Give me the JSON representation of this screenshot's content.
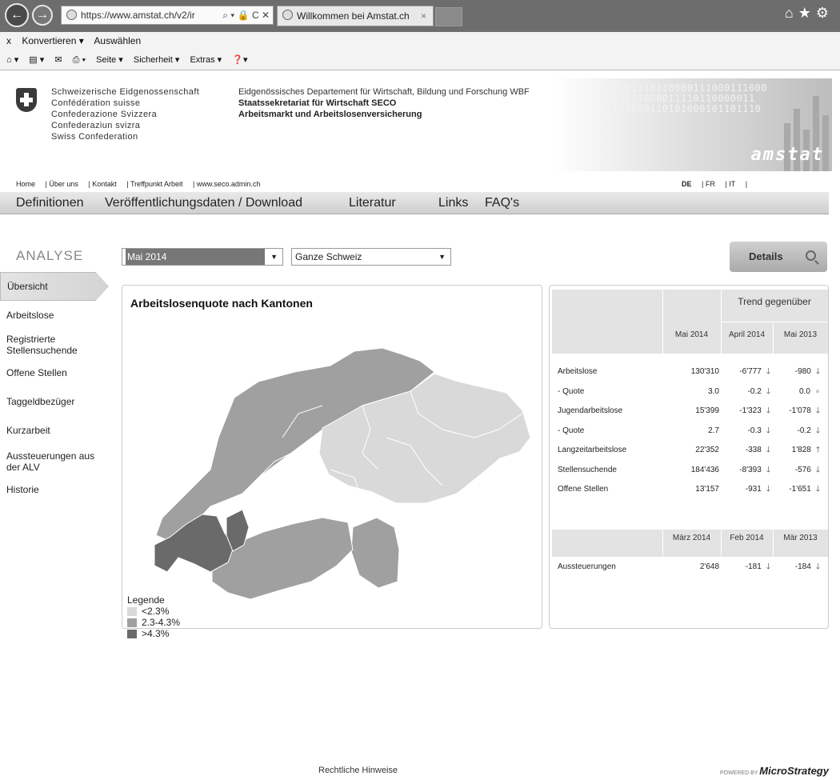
{
  "browser": {
    "address": "https://www.amstat.ch/v2/ir",
    "tab_title": "Willkommen bei Amstat.ch",
    "tab_close": "×",
    "address_tools": "⌕ ▾ 🔒 C ✕",
    "command_bar": {
      "close": "x",
      "convert": "Konvertieren ▾",
      "select": "Auswählen"
    },
    "toolbar": {
      "page": "Seite ▾",
      "security": "Sicherheit ▾",
      "extras": "Extras ▾",
      "help": "❓▾"
    }
  },
  "header": {
    "confederation": [
      "Schweizerische Eidgenossenschaft",
      "Confédération suisse",
      "Confederazione Svizzera",
      "Confederaziun svizra",
      "Swiss Confederation"
    ],
    "department": "Eidgenössisches Departement für Wirtschaft, Bildung und Forschung WBF",
    "secretariat": "Staatssekretariat für Wirtschaft SECO",
    "unit": "Arbeitsmarkt und Arbeitslosenversicherung",
    "brand": "amstat",
    "banner_bits": [
      "0101110110000111000111000",
      "01101000011110110000011",
      "000000110101000101101110"
    ]
  },
  "topnav": [
    "Home",
    "| Über uns",
    "| Kontakt",
    "| Treffpunkt Arbeit",
    "| www.seco.admin.ch"
  ],
  "languages": [
    "DE",
    "| FR",
    "| IT",
    "|"
  ],
  "mainnav": [
    "Definitionen",
    "Veröffentlichungsdaten / Download",
    "Literatur",
    "Links",
    "FAQ's"
  ],
  "analyse_label": "ANALYSE",
  "filters": {
    "month": "Mai 2014",
    "region": "Ganze Schweiz"
  },
  "details_label": "Details",
  "sidebar": [
    {
      "label": "Übersicht",
      "active": true
    },
    {
      "label": "Arbeitslose"
    },
    {
      "label": "Registrierte Stellensuchende"
    },
    {
      "label": "Offene Stellen"
    },
    {
      "label": "Taggeldbezüger"
    },
    {
      "label": "Kurzarbeit"
    },
    {
      "label": "Aussteuerungen aus der ALV"
    },
    {
      "label": "Historie"
    }
  ],
  "map": {
    "title": "Arbeitslosenquote nach Kantonen",
    "legend_title": "Legende",
    "legend": [
      {
        "label": "<2.3%",
        "color": "#d9d9d9"
      },
      {
        "label": "2.3-4.3%",
        "color": "#a0a0a0"
      },
      {
        "label": ">4.3%",
        "color": "#6a6a6a"
      }
    ]
  },
  "table": {
    "trend_title": "Trend gegenüber",
    "columns": [
      "Mai 2014",
      "April 2014",
      "Mai 2013"
    ],
    "rows": [
      {
        "label": "Arbeitslose",
        "v": "130'310",
        "d1": "-6'777",
        "a1": "down",
        "d2": "-980",
        "a2": "down"
      },
      {
        "label": "- Quote",
        "v": "3.0",
        "d1": "-0.2",
        "a1": "down",
        "d2": "0.0",
        "a2": "flat"
      },
      {
        "label": "Jugendarbeitslose",
        "v": "15'399",
        "d1": "-1'323",
        "a1": "down",
        "d2": "-1'078",
        "a2": "down"
      },
      {
        "label": "- Quote",
        "v": "2.7",
        "d1": "-0.3",
        "a1": "down",
        "d2": "-0.2",
        "a2": "down"
      },
      {
        "label": "Langzeitarbeitslose",
        "v": "22'352",
        "d1": "-338",
        "a1": "down",
        "d2": "1'828",
        "a2": "up"
      },
      {
        "label": "Stellensuchende",
        "v": "184'436",
        "d1": "-8'393",
        "a1": "down",
        "d2": "-576",
        "a2": "down"
      },
      {
        "label": "Offene Stellen",
        "v": "13'157",
        "d1": "-931",
        "a1": "down",
        "d2": "-1'651",
        "a2": "down"
      }
    ],
    "columns2": [
      "März 2014",
      "Feb 2014",
      "Mär 2013"
    ],
    "rows2": [
      {
        "label": "Aussteuerungen",
        "v": "2'648",
        "d1": "-181",
        "a1": "down",
        "d2": "-184",
        "a2": "down"
      }
    ]
  },
  "footer": {
    "legal": "Rechtliche Hinweise",
    "powered": "POWERED BY",
    "vendor": "MicroStrategy"
  }
}
